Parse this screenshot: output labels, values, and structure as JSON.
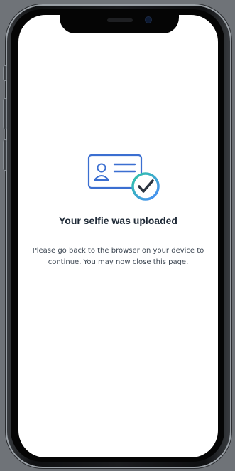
{
  "status": {
    "title": "Your selfie was uploaded",
    "message": "Please go back to the browser on your device to continue. You may now close this page."
  },
  "colors": {
    "id_card_stroke": "#3b6fd1",
    "check_ring_start": "#2ec4a6",
    "check_ring_end": "#4b8df8",
    "check_mark": "#2b3440"
  },
  "icons": {
    "status_illustration": "id-card-check-icon"
  }
}
